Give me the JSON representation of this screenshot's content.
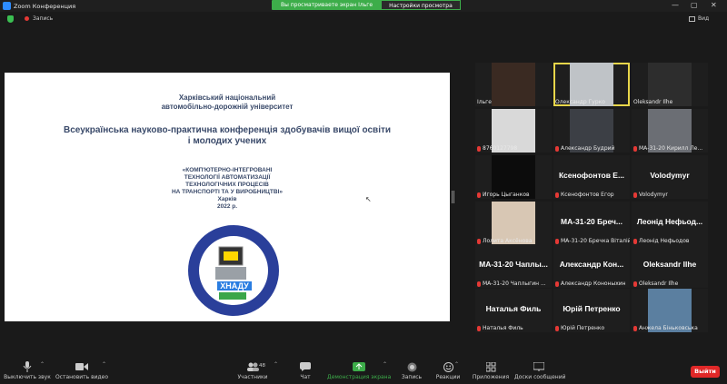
{
  "window": {
    "title": "Zoom Конференция"
  },
  "share_bar": {
    "sharing_text": "Вы просматриваете экран Ільге",
    "view_options": "Настройки просмотра"
  },
  "top": {
    "recording": "Запись",
    "view": "Вид"
  },
  "slide": {
    "university": [
      "Харківський національний",
      "автомобільно-дорожній університет"
    ],
    "conference": [
      "Всеукраїнська науково-практична конференція здобувачів вищої освіти",
      "і молодих учених"
    ],
    "topic": [
      "«КОМП'ЮТЕРНО-ІНТЕГРОВАНІ",
      "ТЕХНОЛОГІЇ АВТОМАТИЗАЦІЇ",
      "ТЕХНОЛОГІЧНИХ ПРОЦЕСІВ",
      "НА ТРАНСПОРТІ ТА У ВИРОБНИЦТВІ»",
      "Харків",
      "2022 р."
    ],
    "logo_text": "ХНАДУ"
  },
  "participants": [
    {
      "label": "Ільге",
      "type": "video",
      "muted": false,
      "active": false,
      "bg": "#3a2a22"
    },
    {
      "label": "Олександр Гурко",
      "type": "video",
      "muted": false,
      "active": true,
      "bg": "#bfc3c7"
    },
    {
      "label": "Oleksandr Ilhe",
      "type": "video",
      "muted": false,
      "active": false,
      "bg": "#2d2d2d"
    },
    {
      "label": "8760127798",
      "type": "video",
      "muted": true,
      "active": false,
      "bg": "#d9d9d9"
    },
    {
      "label": "Александр Будрий",
      "type": "video",
      "muted": true,
      "active": false,
      "bg": "#3c3f45"
    },
    {
      "label": "МА-31-20 Кирилл Ле...",
      "type": "video",
      "muted": true,
      "active": false,
      "bg": "#6b6e74"
    },
    {
      "label": "Игорь Цыганков",
      "type": "video",
      "muted": true,
      "active": false,
      "bg": "#0c0c0c"
    },
    {
      "label": "Ксенофонтов Егор",
      "type": "name",
      "muted": true,
      "active": false,
      "display": "Ксенофонтов Е..."
    },
    {
      "label": "Volodymyr",
      "type": "name",
      "muted": true,
      "active": false,
      "display": "Volodymyr"
    },
    {
      "label": "Лолита Аксёнова",
      "type": "video",
      "muted": true,
      "active": false,
      "bg": "#d8c7b4"
    },
    {
      "label": "МА-31-20 Бречка Віталій",
      "type": "name",
      "muted": true,
      "active": false,
      "display": "МА-31-20 Бреч..."
    },
    {
      "label": "Леонід Нефьодов",
      "type": "name",
      "muted": true,
      "active": false,
      "display": "Леонід Нефьод..."
    },
    {
      "label": "МА-31-20 Чаплыгин ...",
      "type": "name",
      "muted": true,
      "active": false,
      "display": "МА-31-20 Чаплы..."
    },
    {
      "label": "Александр Кононыхин",
      "type": "name",
      "muted": true,
      "active": false,
      "display": "Александр Кон..."
    },
    {
      "label": "Oleksandr Ilhe",
      "type": "name",
      "muted": true,
      "active": false,
      "display": "Oleksandr Ilhe"
    },
    {
      "label": "Наталья Филь",
      "type": "name",
      "muted": true,
      "active": false,
      "display": "Наталья Филь"
    },
    {
      "label": "Юрій Петренко",
      "type": "name",
      "muted": true,
      "active": false,
      "display": "Юрій Петренко"
    },
    {
      "label": "Анжела Біньковська",
      "type": "video",
      "muted": true,
      "active": false,
      "bg": "#5b7fa0"
    }
  ],
  "toolbar": {
    "mute": "Выключить звук",
    "video": "Остановить видео",
    "participants": "Участники",
    "participants_count": "48",
    "chat": "Чат",
    "share": "Демонстрация экрана",
    "record": "Запись",
    "reactions": "Реакции",
    "apps": "Приложения",
    "whiteboards": "Доски сообщений",
    "leave": "Выйти"
  },
  "colors": {
    "share_green": "#3dad4a",
    "leave_red": "#e02828",
    "active_speaker": "#e8d64a"
  }
}
